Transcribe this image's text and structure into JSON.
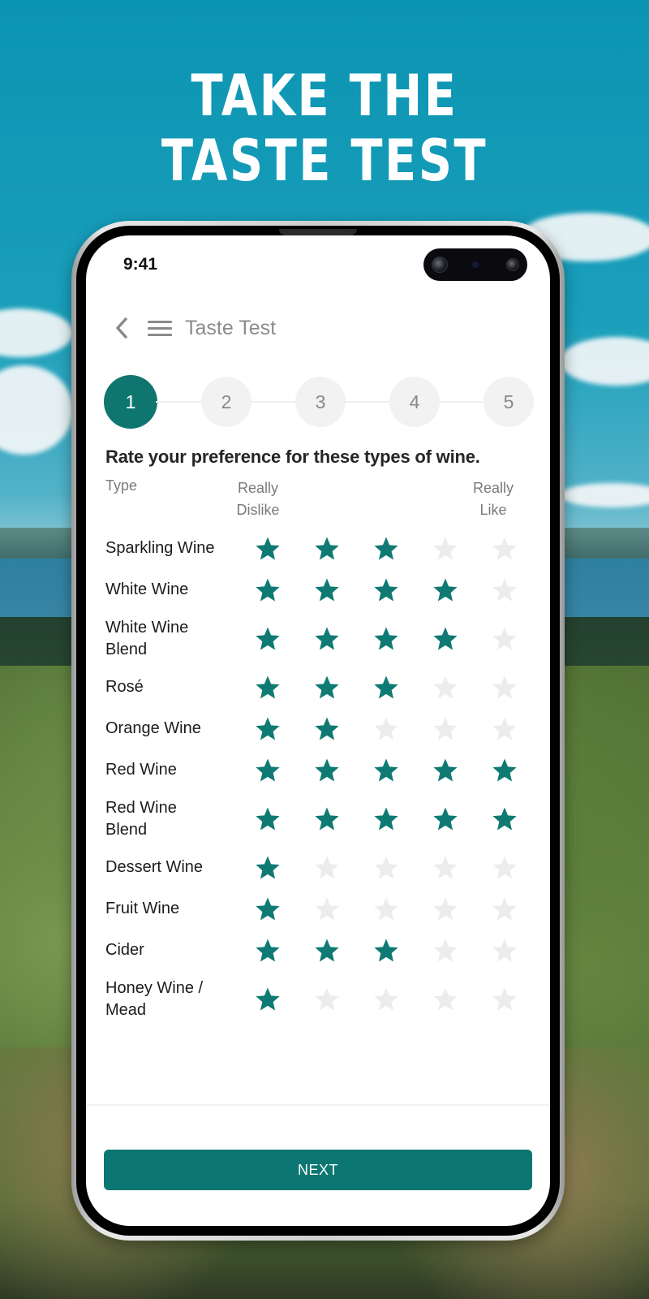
{
  "promo": {
    "headline_line1": "TAKE THE",
    "headline_line2": "TASTE TEST"
  },
  "status_bar": {
    "time": "9:41"
  },
  "app_bar": {
    "back_icon": "chevron-left-icon",
    "menu_icon": "hamburger-menu-icon",
    "title": "Taste Test"
  },
  "stepper": {
    "current_step": 1,
    "steps": [
      "1",
      "2",
      "3",
      "4",
      "5"
    ]
  },
  "question": "Rate your preference for these types of wine.",
  "table_header": {
    "type_label": "Type",
    "low_label_line1": "Really",
    "low_label_line2": "Dislike",
    "high_label_line1": "Really",
    "high_label_line2": "Like"
  },
  "rating_scale_max": 5,
  "colors": {
    "accent": "#0b7672",
    "star_filled": "#0f7a73",
    "star_empty": "#ececec"
  },
  "wine_ratings": [
    {
      "line1": "Sparkling Wine",
      "line2": "",
      "rating": 3
    },
    {
      "line1": "White Wine",
      "line2": "",
      "rating": 4
    },
    {
      "line1": "White Wine",
      "line2": "Blend",
      "rating": 4
    },
    {
      "line1": "Rosé",
      "line2": "",
      "rating": 3
    },
    {
      "line1": "Orange Wine",
      "line2": "",
      "rating": 2
    },
    {
      "line1": "Red Wine",
      "line2": "",
      "rating": 5
    },
    {
      "line1": "Red Wine",
      "line2": "Blend",
      "rating": 5
    },
    {
      "line1": "Dessert Wine",
      "line2": "",
      "rating": 1
    },
    {
      "line1": "Fruit Wine",
      "line2": "",
      "rating": 1
    },
    {
      "line1": "Cider",
      "line2": "",
      "rating": 3
    },
    {
      "line1": "Honey Wine /",
      "line2": "Mead",
      "rating": 1
    }
  ],
  "footer": {
    "next_label": "NEXT"
  }
}
